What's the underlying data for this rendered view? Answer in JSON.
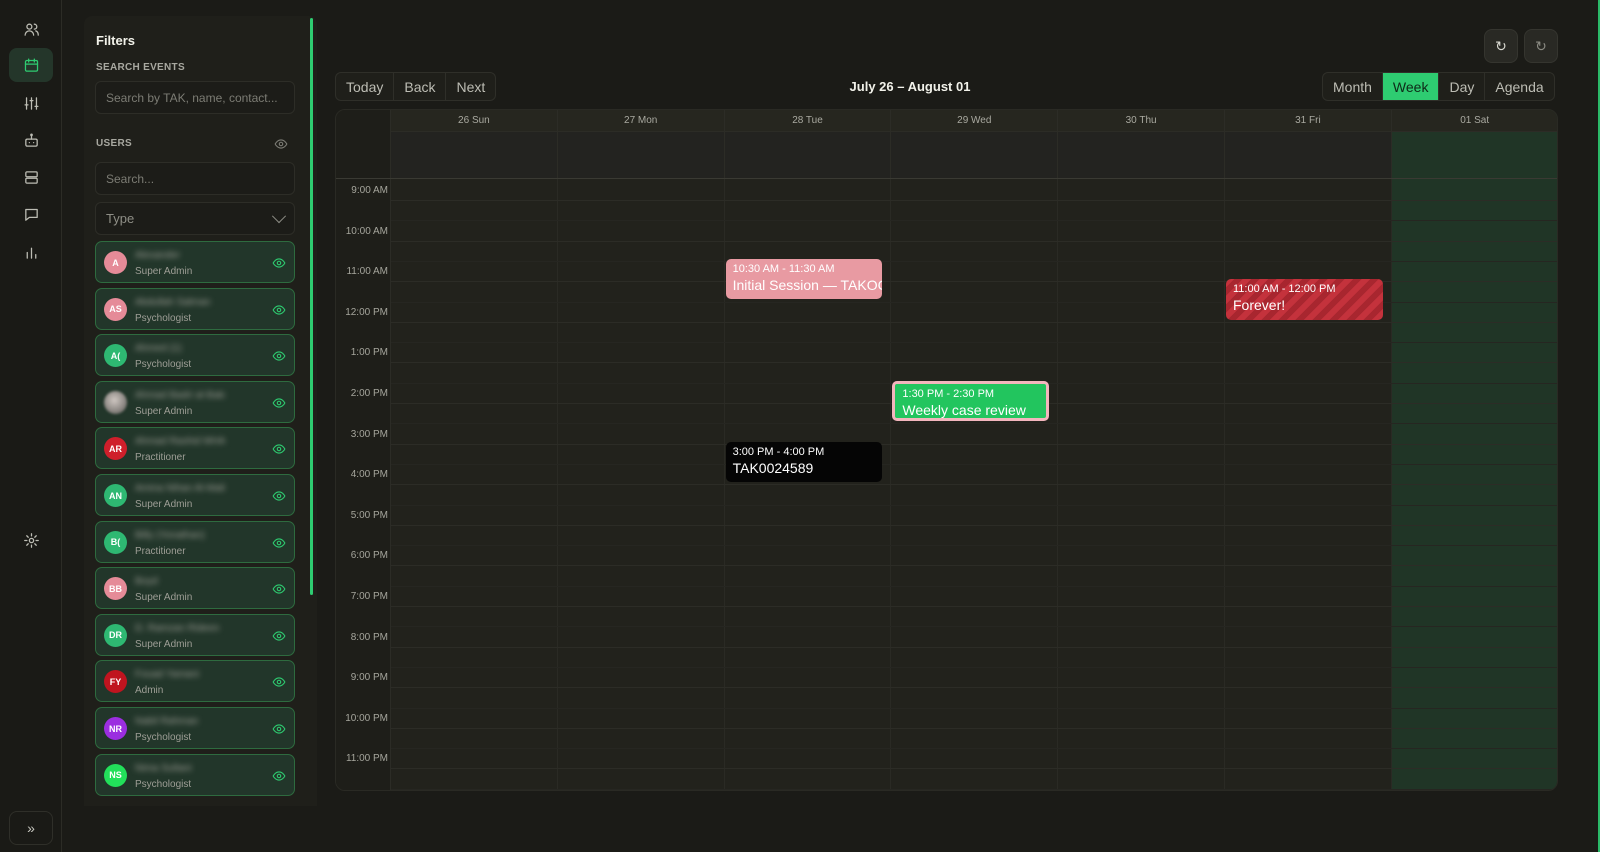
{
  "rail": {
    "icons": [
      "users-icon",
      "calendar-icon",
      "sliders-icon",
      "robot-icon",
      "server-icon",
      "message-icon",
      "bar-chart-icon",
      "settings-icon"
    ],
    "expand_glyph": "»"
  },
  "filters": {
    "title": "Filters",
    "search_label": "SEARCH EVENTS",
    "search_placeholder": "Search by TAK, name, contact...",
    "users_label": "USERS",
    "user_search_placeholder": "Search...",
    "type_placeholder": "Type",
    "users": [
      {
        "initials": "A",
        "name": "Alexander",
        "role": "Super Admin",
        "color": "#e58b98"
      },
      {
        "initials": "AS",
        "name": "Abdullah Salman",
        "role": "Psychologist",
        "color": "#e58b98"
      },
      {
        "initials": "A(",
        "name": "Ahmed (1)",
        "role": "Psychologist",
        "color": "#2eb872"
      },
      {
        "initials": "",
        "name": "Ahmad Badri al-Bakri",
        "role": "Super Admin",
        "color": "#9c9691"
      },
      {
        "initials": "AR",
        "name": "Ahmad Rashid MHA",
        "role": "Practitioner",
        "color": "#cf1f2b"
      },
      {
        "initials": "AN",
        "name": "Amina Nihan Al-Maliki",
        "role": "Super Admin",
        "color": "#2eb872"
      },
      {
        "initials": "B(",
        "name": "Billy (Yonathan)",
        "role": "Practitioner",
        "color": "#2eb872"
      },
      {
        "initials": "BB",
        "name": "Boyd",
        "role": "Super Admin",
        "color": "#e58b98"
      },
      {
        "initials": "DR",
        "name": "D. Ramzan Rideen",
        "role": "Super Admin",
        "color": "#2eb872"
      },
      {
        "initials": "FY",
        "name": "Fouad Yamani",
        "role": "Admin",
        "color": "#c0141f"
      },
      {
        "initials": "NR",
        "name": "Nabil Rahman",
        "role": "Psychologist",
        "color": "#9b2ee0"
      },
      {
        "initials": "NS",
        "name": "Nima Sultani",
        "role": "Psychologist",
        "color": "#22e05a"
      }
    ]
  },
  "toolbar": {
    "nav": [
      "Today",
      "Back",
      "Next"
    ],
    "range_title": "July 26 – August 01",
    "views": [
      "Month",
      "Week",
      "Day",
      "Agenda"
    ],
    "active_view": "Week",
    "top_icons": [
      "refresh-icon",
      "sync-icon"
    ]
  },
  "calendar": {
    "days": [
      "26 Sun",
      "27 Mon",
      "28 Tue",
      "29 Wed",
      "30 Thu",
      "31 Fri",
      "01 Sat"
    ],
    "times": [
      "9:00 AM",
      "10:00 AM",
      "11:00 AM",
      "12:00 PM",
      "1:00 PM",
      "2:00 PM",
      "3:00 PM",
      "4:00 PM",
      "5:00 PM",
      "6:00 PM",
      "7:00 PM",
      "8:00 PM",
      "9:00 PM",
      "10:00 PM",
      "11:00 PM"
    ],
    "events": [
      {
        "day": 2,
        "start": 10.5,
        "end": 11.5,
        "time": "10:30 AM - 11:30 AM",
        "title": "Initial Session — TAKOC",
        "style": "pink"
      },
      {
        "day": 5,
        "start": 11,
        "end": 12,
        "time": "11:00 AM - 12:00 PM",
        "title": "Forever!",
        "style": "red"
      },
      {
        "day": 3,
        "start": 13.5,
        "end": 14.5,
        "time": "1:30 PM - 2:30 PM",
        "title": "Weekly case review",
        "style": "green"
      },
      {
        "day": 2,
        "start": 15,
        "end": 16,
        "time": "3:00 PM - 4:00 PM",
        "title": "TAK0024589",
        "style": "black"
      }
    ]
  }
}
